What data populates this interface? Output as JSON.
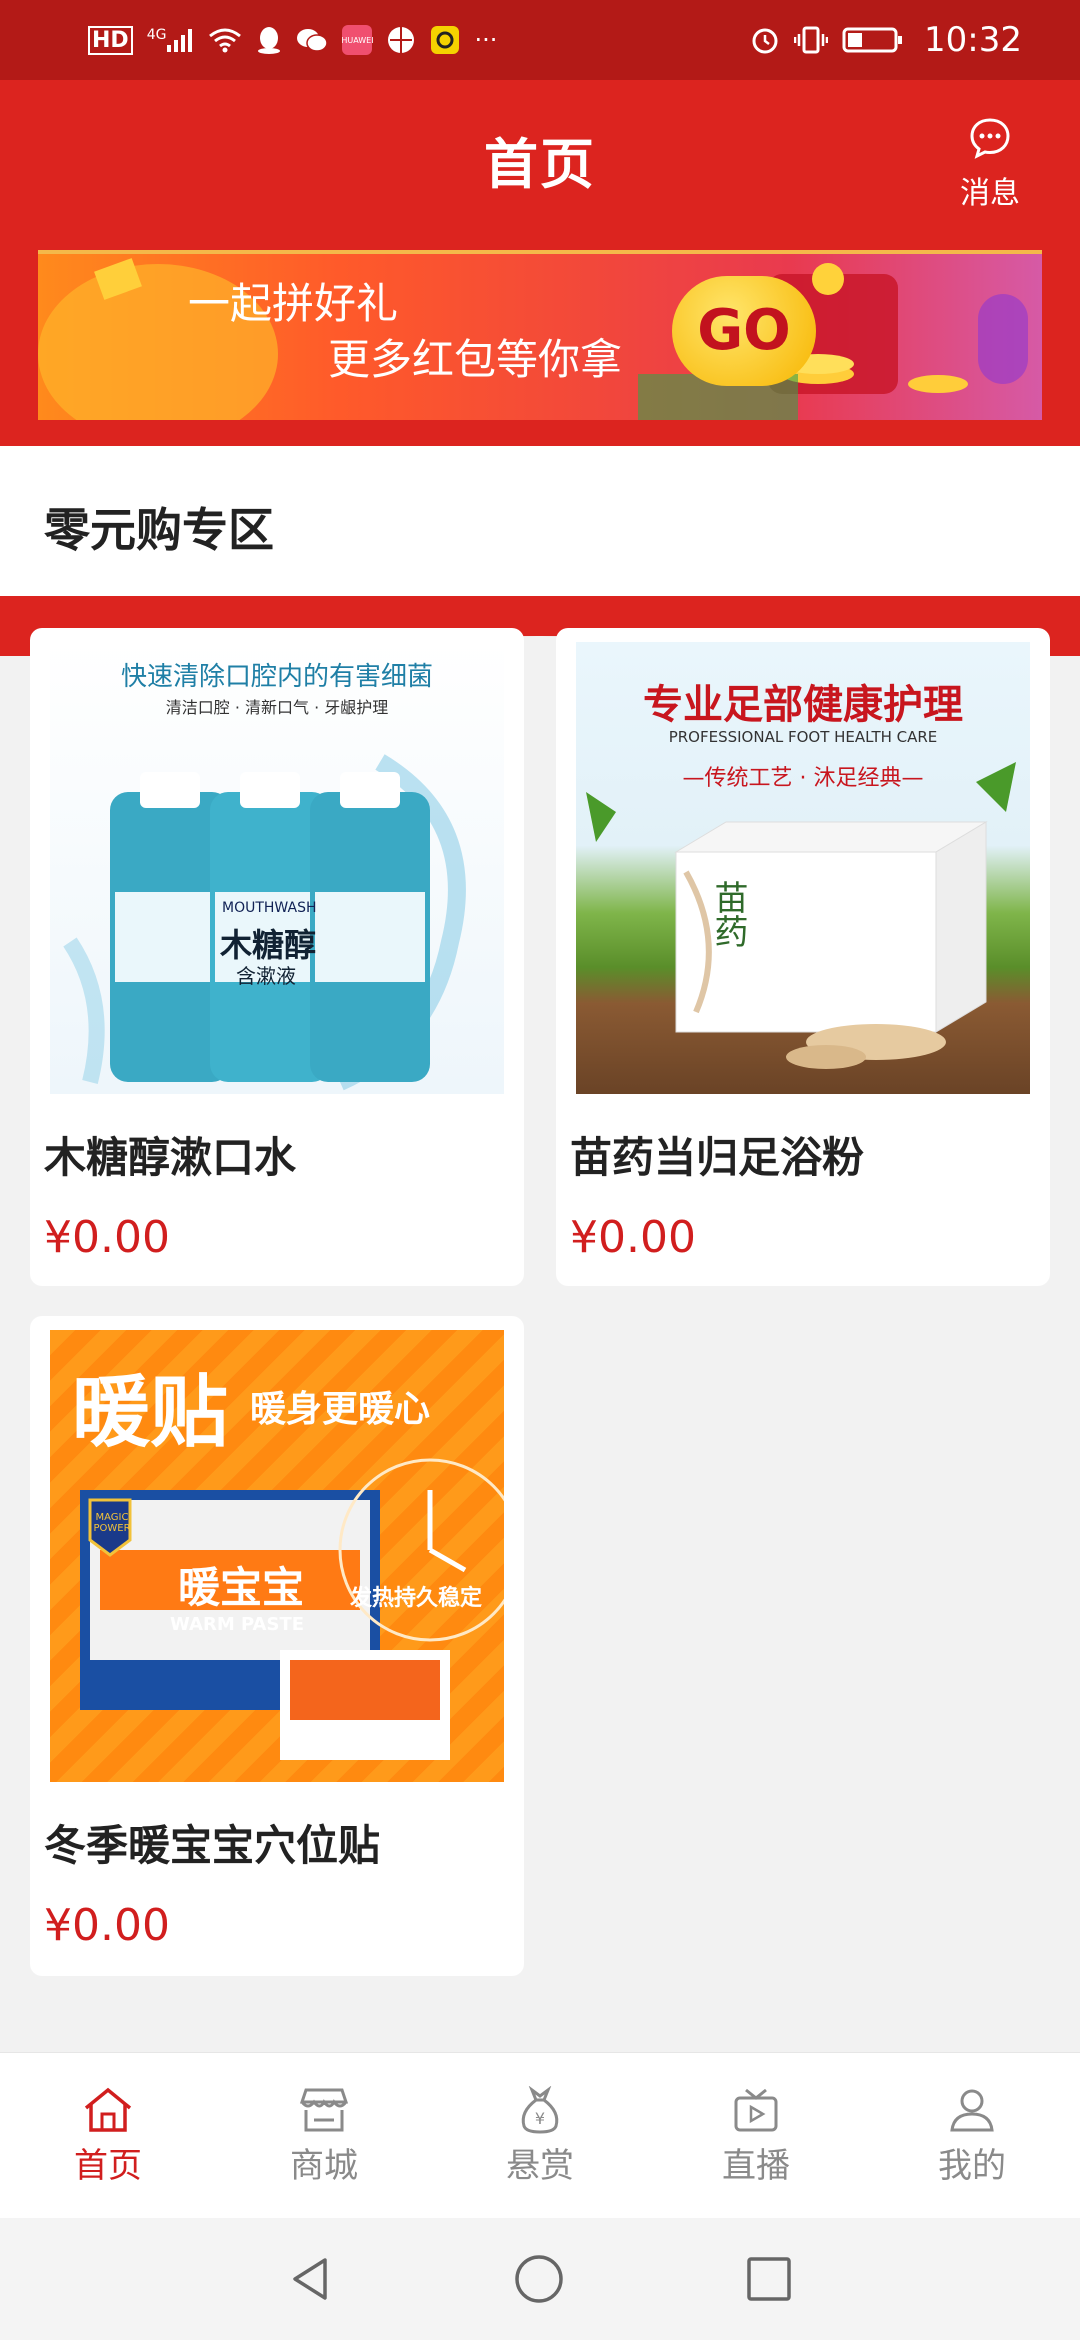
{
  "status_bar": {
    "left_icons": [
      "hd-icon",
      "signal-4g-icon",
      "wifi-icon",
      "qq-icon",
      "wechat-icon",
      "huawei-app-icon",
      "browser-icon",
      "app-icon"
    ],
    "right_icons": [
      "alarm-icon",
      "vibrate-icon",
      "battery-icon"
    ],
    "time": "10:32",
    "hd": "HD",
    "net": "4G",
    "huawei": "HUAWEI",
    "more": "···"
  },
  "header": {
    "title": "首页",
    "message_label": "消息"
  },
  "banner": {
    "line1": "一起拼好礼",
    "line2": "更多红包等你拿",
    "go": "GO"
  },
  "section": {
    "title": "零元购专区"
  },
  "products": [
    {
      "name": "木糖醇漱口水",
      "price": "¥0.00",
      "img_text": {
        "headline": "快速清除口腔内的有害细菌",
        "sub": "清洁口腔 · 清新口气 · 牙龈护理",
        "bottle_label": "木糖醇",
        "bottle_sub": "含漱液",
        "brand": "MOUTHWASH"
      }
    },
    {
      "name": "苗药当归足浴粉",
      "price": "¥0.00",
      "img_text": {
        "headline": "专业足部健康护理",
        "en": "PROFESSIONAL FOOT HEALTH CARE",
        "sub": "—传统工艺 · 沐足经典—",
        "box": "苗药"
      }
    },
    {
      "name": "冬季暖宝宝穴位贴",
      "price": "¥0.00",
      "img_text": {
        "headline": "暖贴",
        "tagline": "暖身更暖心",
        "brand": "MAGIC POWER",
        "product": "暖宝宝",
        "en": "WARM PASTE",
        "side": "发热持久稳定"
      }
    }
  ],
  "tabbar": {
    "tabs": [
      {
        "label": "首页",
        "icon": "home-icon"
      },
      {
        "label": "商城",
        "icon": "store-icon"
      },
      {
        "label": "悬赏",
        "icon": "money-bag-icon"
      },
      {
        "label": "直播",
        "icon": "tv-icon"
      },
      {
        "label": "我的",
        "icon": "user-icon"
      }
    ]
  },
  "colors": {
    "primary": "#dc241f",
    "status_bar": "#b31a17",
    "price": "#d11e1e"
  }
}
